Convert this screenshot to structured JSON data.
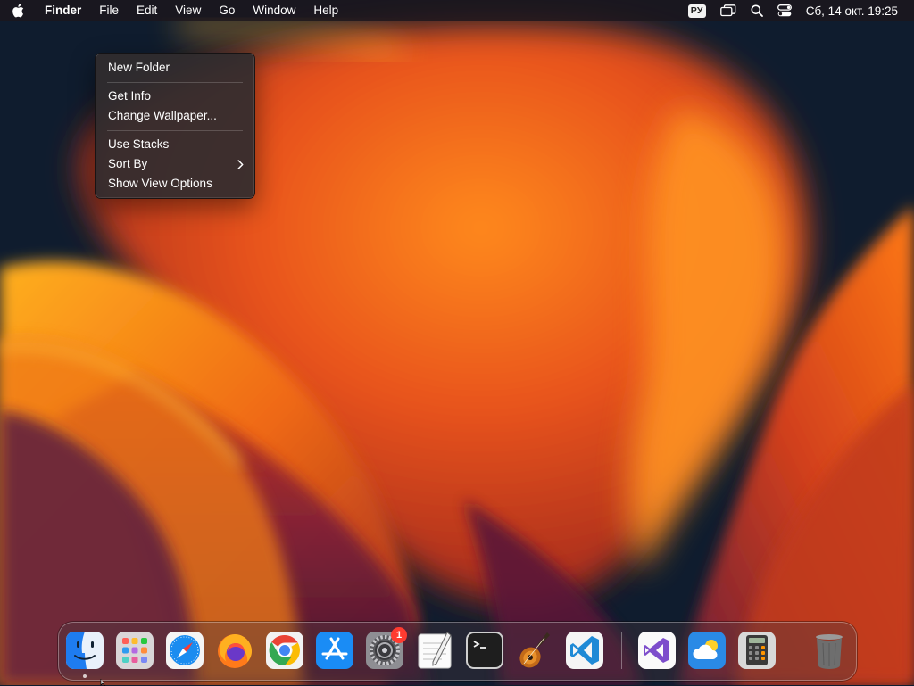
{
  "menubar": {
    "app_name": "Finder",
    "menus": [
      "File",
      "Edit",
      "View",
      "Go",
      "Window",
      "Help"
    ],
    "input_language": "РУ",
    "datetime": "Сб, 14 окт.  19:25",
    "status_icons": [
      "input-language-icon",
      "screen-mirroring-icon",
      "spotlight-search-icon",
      "control-center-icon"
    ]
  },
  "context_menu": {
    "items": [
      "New Folder",
      "Get Info",
      "Change Wallpaper...",
      "Use Stacks",
      "Sort By",
      "Show View Options"
    ]
  },
  "dock": {
    "apps": [
      "Finder",
      "Launchpad",
      "Safari",
      "Firefox",
      "Google Chrome",
      "App Store",
      "System Settings",
      "TextEdit",
      "Terminal",
      "GarageBand",
      "Visual Studio Code",
      "Visual Studio",
      "Weather",
      "Calculator",
      "Trash"
    ],
    "system_settings_badge": "1",
    "running": [
      "Finder"
    ]
  },
  "colors": {
    "menubar_bg": "#1c161c",
    "menu_bg": "#302c2e",
    "badge_red": "#ff3b30",
    "wallpaper_orange": "#ff7a10",
    "wallpaper_purple": "#6a1d3c",
    "wallpaper_navy": "#0f1c2e"
  }
}
